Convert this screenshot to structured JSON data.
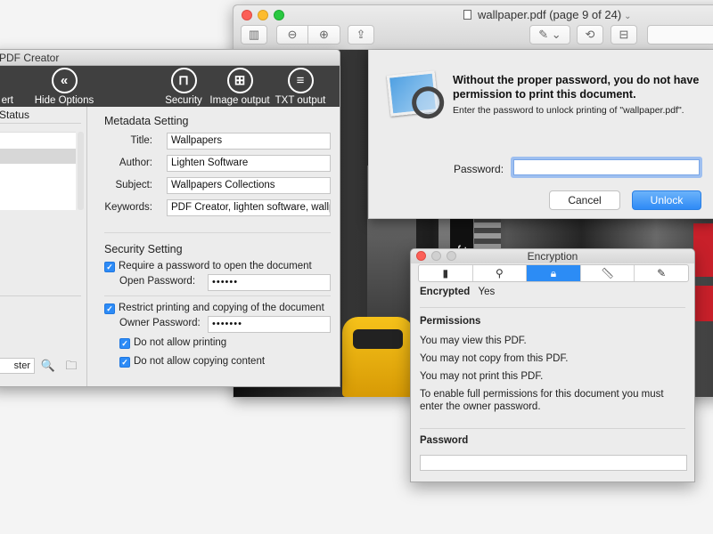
{
  "preview": {
    "title": "wallpaper.pdf (page 9 of 24)",
    "photo_sign_text": "Jak",
    "dialog": {
      "heading": "Without the proper password, you do not have permission to print this document.",
      "subtext": "Enter the password to unlock printing of \"wallpaper.pdf\".",
      "password_label": "Password:",
      "password_value": "",
      "cancel_label": "Cancel",
      "unlock_label": "Unlock",
      "accent": "#2e8af6"
    }
  },
  "creator": {
    "title": "PDF Creator",
    "toolbar": {
      "convert_label": "ert",
      "hide_options_label": "Hide Options",
      "security_label": "Security",
      "image_output_label": "Image output",
      "txt_output_label": "TXT output"
    },
    "left": {
      "status_header": "Status",
      "output_folder_value": "ster"
    },
    "metadata": {
      "section_title": "Metadata Setting",
      "title_label": "Title:",
      "title_value": "Wallpapers",
      "author_label": "Author:",
      "author_value": "Lighten Software",
      "subject_label": "Subject:",
      "subject_value": "Wallpapers Collections",
      "keywords_label": "Keywords:",
      "keywords_value": "PDF Creator, lighten software, wallp"
    },
    "security": {
      "section_title": "Security Setting",
      "require_open_label": "Require a password to open the document",
      "open_password_label": "Open Password:",
      "open_password_value": "••••••",
      "restrict_label": "Restrict printing and copying of the document",
      "owner_password_label": "Owner Password:",
      "owner_password_value": "•••••••",
      "no_printing_label": "Do not allow printing",
      "no_copying_label": "Do not allow copying content"
    }
  },
  "encryption": {
    "title": "Encryption",
    "encrypted_label": "Encrypted",
    "encrypted_value": "Yes",
    "permissions_title": "Permissions",
    "perm_view": "You may view this PDF.",
    "perm_copy": "You may not copy from this PDF.",
    "perm_print": "You may not print this PDF.",
    "perm_note": "To enable full permissions for this document you must enter the owner password.",
    "password_title": "Password",
    "password_value": "",
    "active_tab_color": "#2c8cf5"
  }
}
